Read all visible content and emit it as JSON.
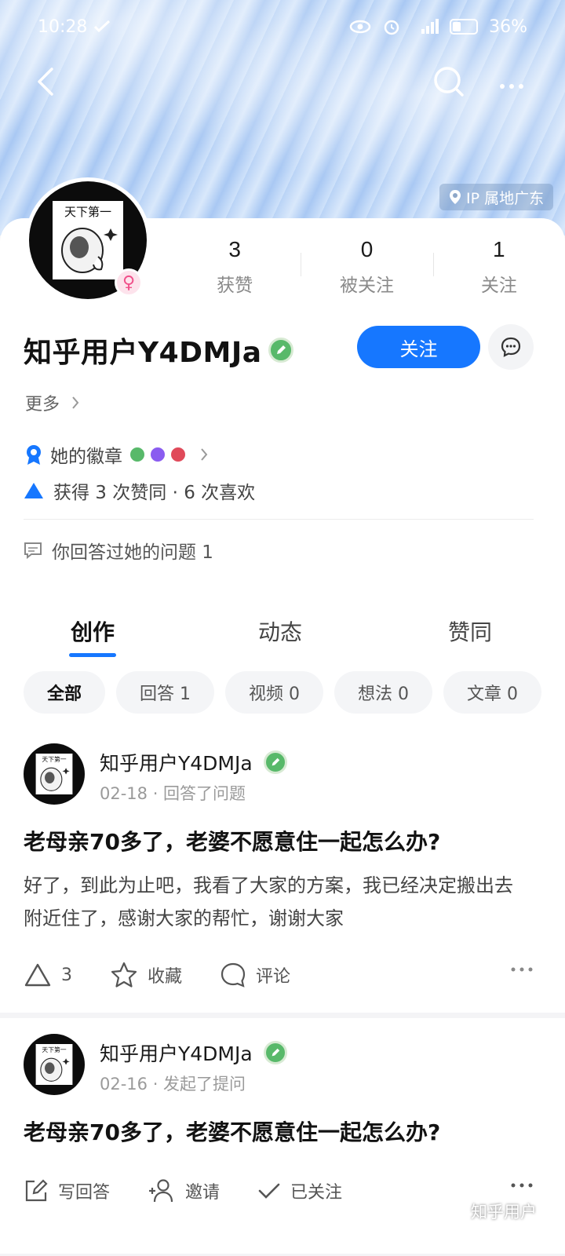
{
  "status_bar": {
    "time": "10:28",
    "battery_pct": "36%"
  },
  "profile": {
    "ip_location": "IP 属地广东",
    "avatar_text": "天下第一",
    "stats": [
      {
        "value": "3",
        "label": "获赞"
      },
      {
        "value": "0",
        "label": "被关注"
      },
      {
        "value": "1",
        "label": "关注"
      }
    ],
    "username": "知乎用户Y4DMJa",
    "follow_label": "关注",
    "more_label": "更多",
    "badges_label": "她的徽章",
    "likes_summary": "获得 3 次赞同 · 6 次喜欢",
    "answered_question": "你回答过她的问题 1"
  },
  "tabs": [
    "创作",
    "动态",
    "赞同"
  ],
  "filters": [
    "全部",
    "回答 1",
    "视频 0",
    "想法 0",
    "文章 0"
  ],
  "feed": [
    {
      "author": "知乎用户Y4DMJa",
      "meta": "02-18 · 回答了问题",
      "title": "老母亲70多了，老婆不愿意住一起怎么办?",
      "excerpt": "好了，到此为止吧，我看了大家的方案，我已经决定搬出去附近住了，感谢大家的帮忙，谢谢大家",
      "actions": {
        "upvote_count": "3",
        "favorite": "收藏",
        "comment": "评论"
      }
    },
    {
      "author": "知乎用户Y4DMJa",
      "meta": "02-16 · 发起了提问",
      "title": "老母亲70多了，老婆不愿意住一起怎么办?",
      "actions": {
        "write_answer": "写回答",
        "invite": "邀请",
        "followed": "已关注"
      }
    }
  ],
  "watermark": "知乎用户",
  "colors": {
    "accent": "#1677ff",
    "verified": "#58b96a"
  }
}
